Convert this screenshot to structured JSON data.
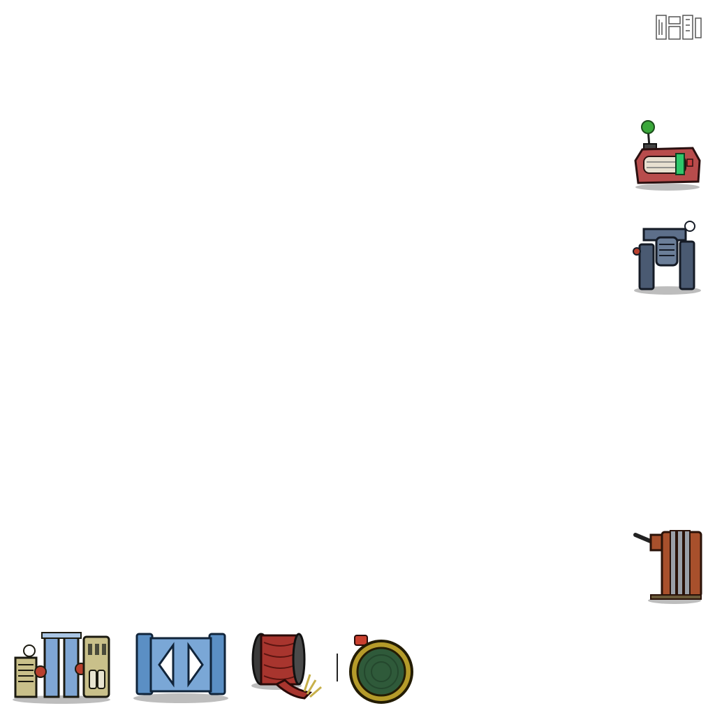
{
  "sprites": [
    {
      "name": "corner-glyph",
      "icon": "ornate-glyph-icon"
    },
    {
      "name": "radio-device",
      "icon": "radio-transmitter-icon",
      "colors": {
        "body": "#b84c4c",
        "antenna": "#3aa83a",
        "panel": "#2ec76a"
      }
    },
    {
      "name": "pipe-machine",
      "icon": "pipe-valve-machine-icon",
      "colors": {
        "body": "#4a5a72"
      }
    },
    {
      "name": "cable-spool-stand",
      "icon": "cable-spool-stand-icon",
      "colors": {
        "frame": "#a8502c",
        "coils": "#9aa0a8"
      }
    },
    {
      "name": "generator",
      "icon": "generator-tower-icon",
      "colors": {
        "frame": "#c9c08a",
        "pillars": "#7fa6d4",
        "accent": "#b8402e"
      }
    },
    {
      "name": "blue-shutter",
      "icon": "blue-shutter-panel-icon",
      "colors": {
        "body": "#5b8fc4"
      }
    },
    {
      "name": "frayed-wire-spool",
      "icon": "frayed-wire-spool-icon",
      "colors": {
        "wire": "#a8352e"
      }
    },
    {
      "name": "gold-ring",
      "icon": "gold-ring-inlet-icon",
      "colors": {
        "rim": "#b59b2a",
        "center": "#2f5a3a"
      }
    }
  ]
}
